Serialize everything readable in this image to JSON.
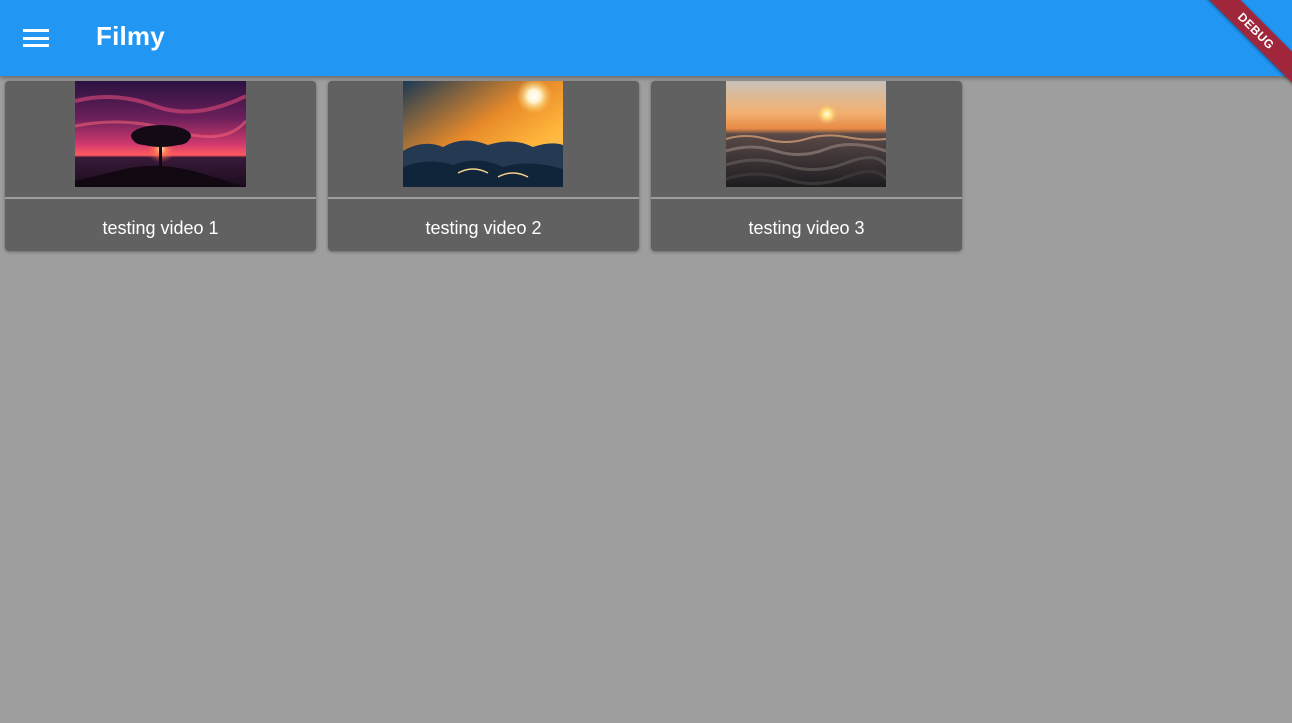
{
  "app": {
    "title": "Filmy",
    "debug_banner": "DEBUG"
  },
  "colors": {
    "appbar": "#2196f3",
    "background": "#9e9e9e",
    "card": "#616161",
    "debug_ribbon": "#a0263c"
  },
  "icons": {
    "menu": "hamburger-menu-icon"
  },
  "videos": [
    {
      "title": "testing video 1",
      "thumbnail": "tree silhouette at sunset over sea with pink clouds"
    },
    {
      "title": "testing video 2",
      "thumbnail": "sun above clouds, golden sky"
    },
    {
      "title": "testing video 3",
      "thumbnail": "ocean waves at sunset"
    }
  ]
}
